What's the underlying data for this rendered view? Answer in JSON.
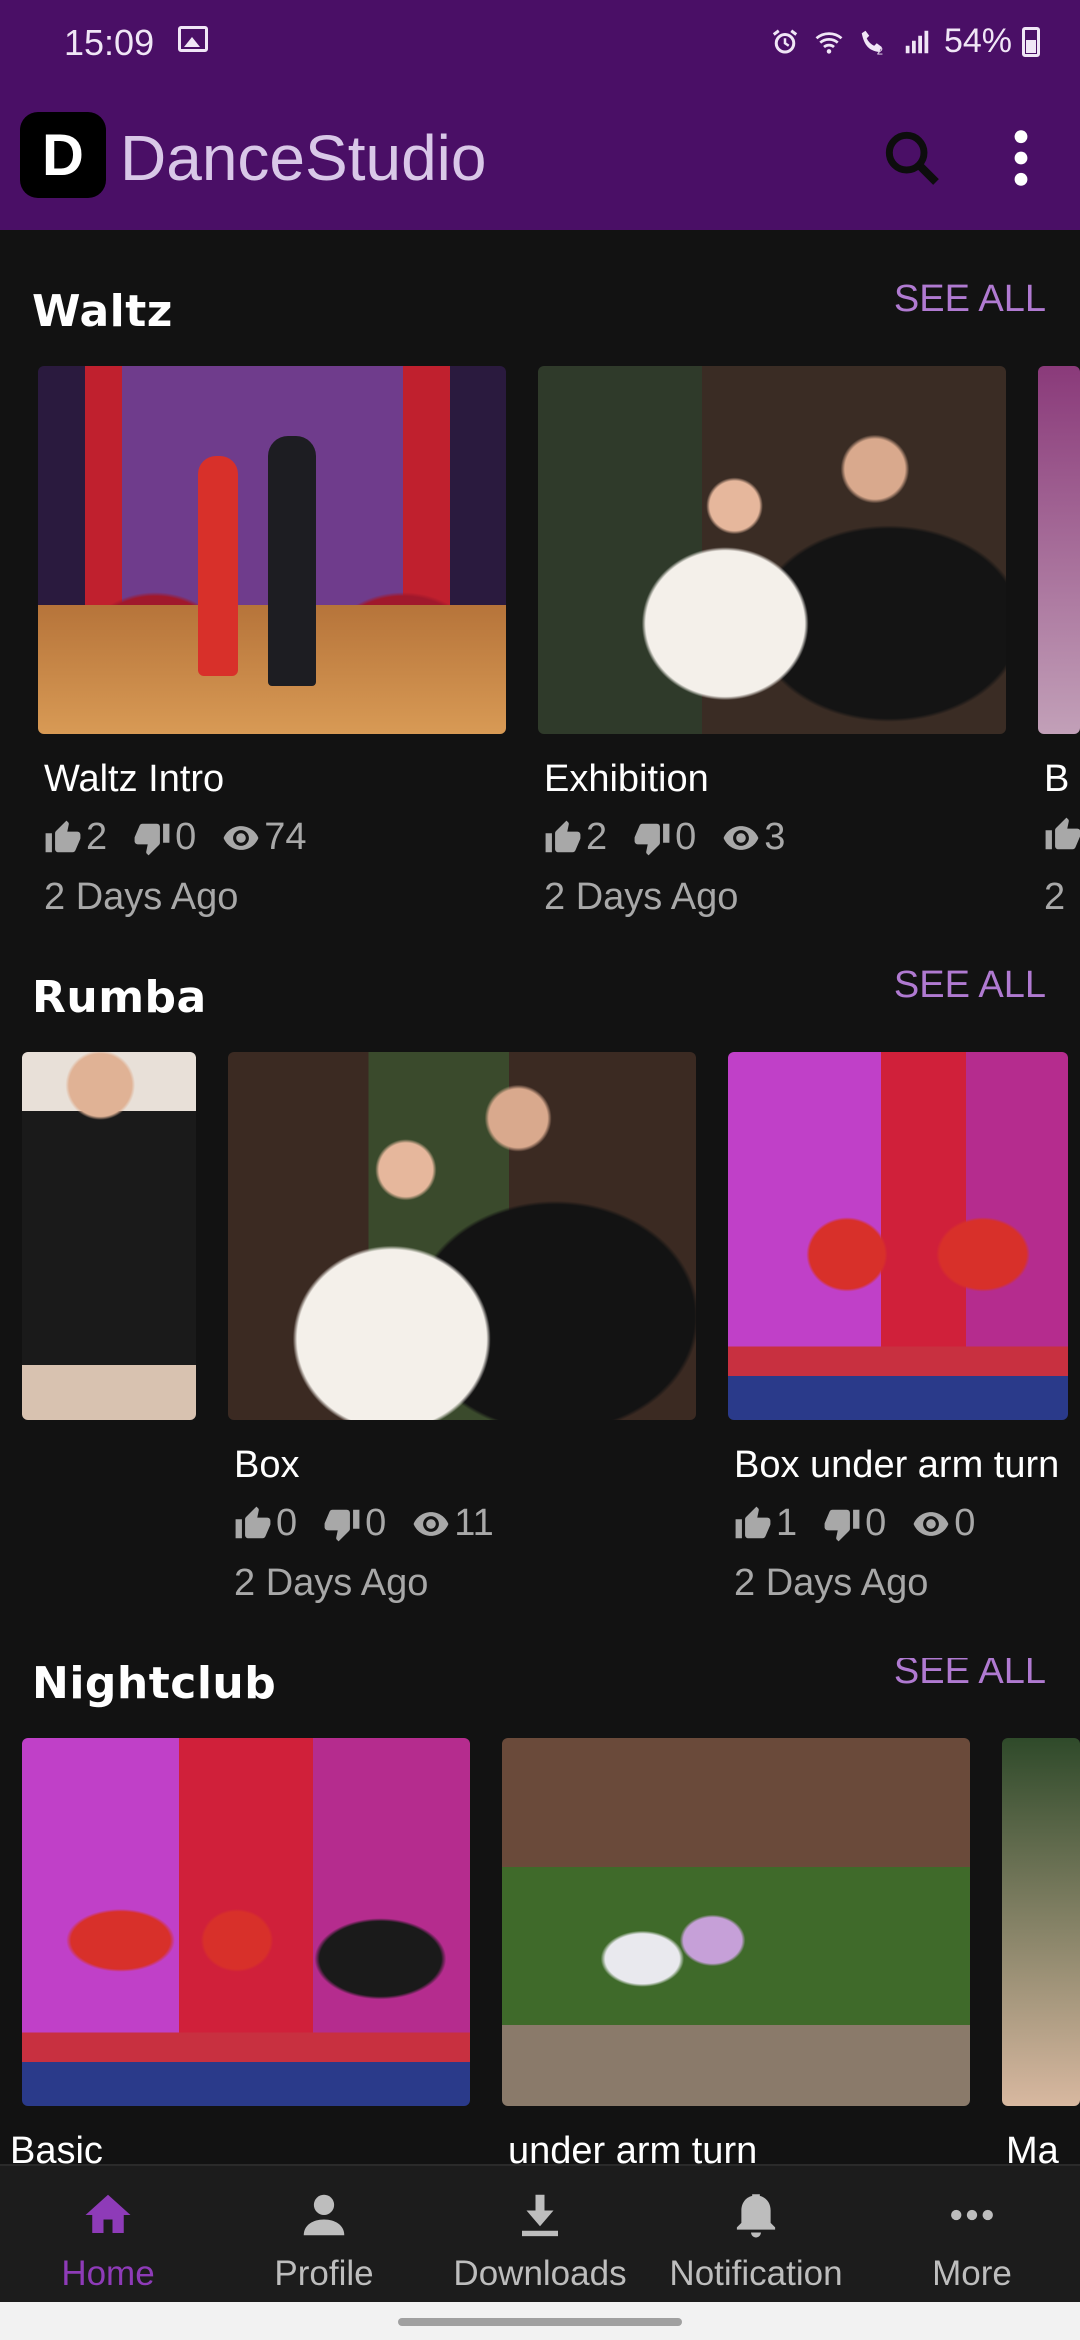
{
  "status_bar": {
    "time": "15:09",
    "battery": "54%"
  },
  "app_bar": {
    "logo_letter": "D",
    "title": "DanceStudio"
  },
  "sections": [
    {
      "title": "Waltz",
      "see_all": "SEE ALL",
      "cards": [
        {
          "title": "Waltz Intro",
          "likes": "2",
          "dislikes": "0",
          "views": "74",
          "date": "2 Days Ago"
        },
        {
          "title": "Exhibition",
          "likes": "2",
          "dislikes": "0",
          "views": "3",
          "date": "2 Days Ago"
        },
        {
          "title": "B",
          "date": "2"
        }
      ]
    },
    {
      "title": "Rumba",
      "see_all": "SEE ALL",
      "cards": [
        {
          "title": "Box",
          "likes": "0",
          "dislikes": "0",
          "views": "11",
          "date": "2 Days Ago"
        },
        {
          "title": "Box under arm turn",
          "likes": "1",
          "dislikes": "0",
          "views": "0",
          "date": "2 Days Ago"
        }
      ]
    },
    {
      "title": "Nightclub",
      "see_all": "SEE ALL",
      "cards": [
        {
          "title": "Basic"
        },
        {
          "title": "under arm turn"
        },
        {
          "title": "Ma"
        }
      ]
    }
  ],
  "bottom_nav": [
    {
      "label": "Home",
      "icon": "home-icon",
      "active": true
    },
    {
      "label": "Profile",
      "icon": "profile-icon"
    },
    {
      "label": "Downloads",
      "icon": "download-icon"
    },
    {
      "label": "Notification",
      "icon": "bell-icon"
    },
    {
      "label": "More",
      "icon": "more-horizontal-icon"
    }
  ],
  "colors": {
    "accent": "#8e3bb8",
    "header": "#4a0f66",
    "see_all": "#b07ad1",
    "background": "#121212"
  }
}
